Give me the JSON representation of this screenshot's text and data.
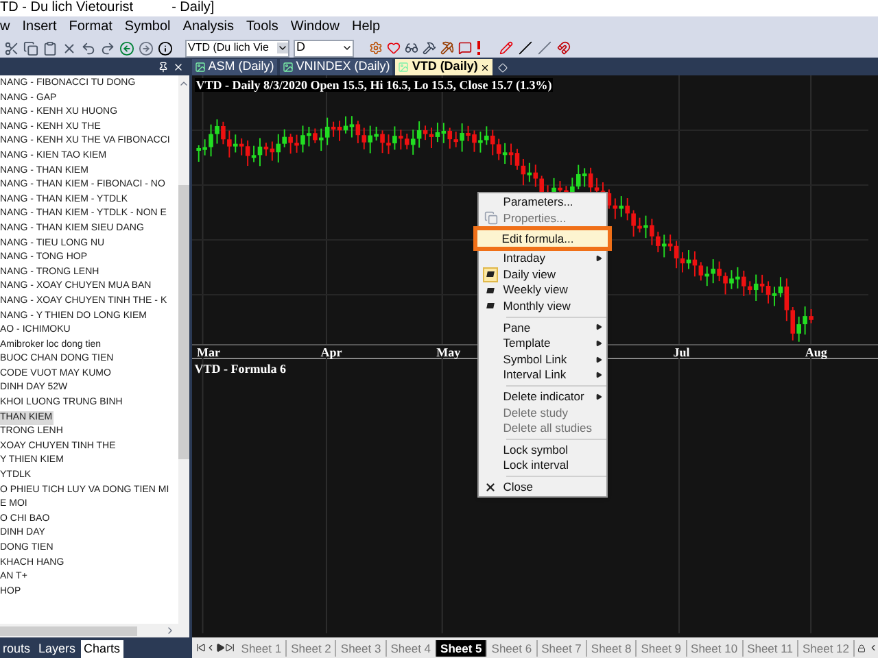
{
  "window": {
    "title": "TD - Du lich Vietourist",
    "title_suffix": "- Daily]"
  },
  "menu_bar": [
    "w",
    "Insert",
    "Format",
    "Symbol",
    "Analysis",
    "Tools",
    "Window",
    "Help"
  ],
  "toolbar": {
    "symbol_combo": "VTD (Du lich Vie",
    "interval_combo": "D"
  },
  "chart_tabs": [
    {
      "label": "ASM (Daily)",
      "selected": false
    },
    {
      "label": "VNINDEX (Daily)",
      "selected": false
    },
    {
      "label": "VTD (Daily)",
      "selected": true
    }
  ],
  "formula_list": [
    {
      "label": "NANG - FIBONACCI TU DONG",
      "selected": false
    },
    {
      "label": "NANG - GAP",
      "selected": false
    },
    {
      "label": "NANG - KENH XU HUONG",
      "selected": false
    },
    {
      "label": "NANG - KENH XU THE",
      "selected": false
    },
    {
      "label": "NANG - KENH XU THE VA FIBONACCI",
      "selected": false
    },
    {
      "label": "NANG - KIEN TAO KIEM",
      "selected": false
    },
    {
      "label": "NANG - THAN KIEM",
      "selected": false
    },
    {
      "label": "NANG - THAN KIEM - FIBONACI - NO",
      "selected": false
    },
    {
      "label": "NANG - THAN KIEM - YTDLK",
      "selected": false
    },
    {
      "label": "NANG - THAN KIEM - YTDLK - NON E",
      "selected": false
    },
    {
      "label": "NANG - THAN KIEM SIEU DANG",
      "selected": false
    },
    {
      "label": "NANG - TIEU LONG NU",
      "selected": false
    },
    {
      "label": "NANG - TONG HOP",
      "selected": false
    },
    {
      "label": "NANG - TRONG LENH",
      "selected": false
    },
    {
      "label": "NANG - XOAY CHUYEN MUA BAN",
      "selected": false
    },
    {
      "label": "NANG - XOAY CHUYEN TINH THE - K",
      "selected": false
    },
    {
      "label": "NANG - Y THIEN DO LONG KIEM",
      "selected": false
    },
    {
      "label": "AO - ICHIMOKU",
      "selected": false
    },
    {
      "label": "Amibroker loc dong tien",
      "selected": false
    },
    {
      "label": "BUOC CHAN DONG TIEN",
      "selected": false
    },
    {
      "label": "CODE VUOT MAY KUMO",
      "selected": false
    },
    {
      "label": "DINH DAY 52W",
      "selected": false
    },
    {
      "label": "KHOI LUONG TRUNG BINH",
      "selected": false
    },
    {
      "label": "THAN KIEM",
      "selected": true
    },
    {
      "label": "TRONG LENH",
      "selected": false
    },
    {
      "label": "XOAY CHUYEN TINH THE",
      "selected": false
    },
    {
      "label": "Y THIEN KIEM",
      "selected": false
    },
    {
      "label": "YTDLK",
      "selected": false
    },
    {
      "label": "O PHIEU TICH LUY VA DONG TIEN MI",
      "selected": false
    },
    {
      "label": "E MOI",
      "selected": false
    },
    {
      "label": "O CHI BAO",
      "selected": false
    },
    {
      "label": "DINH DAY",
      "selected": false
    },
    {
      "label": "DONG TIEN",
      "selected": false
    },
    {
      "label": "KHACH HANG",
      "selected": false
    },
    {
      "label": "AN T+",
      "selected": false
    },
    {
      "label": "HOP",
      "selected": false
    }
  ],
  "panel_tabs": [
    {
      "label": "routs",
      "selected": false
    },
    {
      "label": "Layers",
      "selected": false
    },
    {
      "label": "Charts",
      "selected": true
    }
  ],
  "chart": {
    "price_title": "VTD - Daily 8/3/2020 Open 15.5, Hi 16.5, Lo 15.5, Close 15.7 (1.3%)",
    "months": [
      {
        "label": "Mar"
      },
      {
        "label": "Apr"
      },
      {
        "label": "May"
      },
      {
        "label": "Jul"
      },
      {
        "label": "Aug"
      }
    ],
    "lower_title": "VTD - Formula 6"
  },
  "context_menu": [
    {
      "kind": "item",
      "label": "Parameters...",
      "disabled": false,
      "highlighted": false
    },
    {
      "kind": "item",
      "label": "Properties...",
      "disabled": true,
      "highlighted": false
    },
    {
      "kind": "item",
      "label": "Edit formula...",
      "disabled": false,
      "highlighted": true
    },
    {
      "kind": "submenu",
      "label": "Intraday",
      "disabled": false,
      "highlighted": false
    },
    {
      "kind": "view",
      "label": "Daily view",
      "disabled": false,
      "highlighted": false,
      "checked": true
    },
    {
      "kind": "view",
      "label": "Weekly view",
      "disabled": false,
      "highlighted": false,
      "checked": false
    },
    {
      "kind": "view",
      "label": "Monthly view",
      "disabled": false,
      "highlighted": false,
      "checked": false
    },
    {
      "kind": "separator"
    },
    {
      "kind": "submenu",
      "label": "Pane",
      "disabled": false,
      "highlighted": false
    },
    {
      "kind": "submenu",
      "label": "Template",
      "disabled": false,
      "highlighted": false
    },
    {
      "kind": "submenu",
      "label": "Symbol Link",
      "disabled": false,
      "highlighted": false
    },
    {
      "kind": "submenu",
      "label": "Interval Link",
      "disabled": false,
      "highlighted": false
    },
    {
      "kind": "separator"
    },
    {
      "kind": "submenu",
      "label": "Delete indicator",
      "disabled": false,
      "highlighted": false
    },
    {
      "kind": "item",
      "label": "Delete study",
      "disabled": true,
      "highlighted": false
    },
    {
      "kind": "item",
      "label": "Delete all studies",
      "disabled": true,
      "highlighted": false
    },
    {
      "kind": "separator"
    },
    {
      "kind": "item",
      "label": "Lock symbol",
      "disabled": false,
      "highlighted": false
    },
    {
      "kind": "item",
      "label": "Lock interval",
      "disabled": false,
      "highlighted": false
    },
    {
      "kind": "separator"
    },
    {
      "kind": "close",
      "label": "Close",
      "disabled": false,
      "highlighted": false
    }
  ],
  "sheet_tabs": [
    {
      "label": "Sheet 1",
      "selected": false
    },
    {
      "label": "Sheet 2",
      "selected": false
    },
    {
      "label": "Sheet 3",
      "selected": false
    },
    {
      "label": "Sheet 4",
      "selected": false
    },
    {
      "label": "Sheet 5",
      "selected": true
    },
    {
      "label": "Sheet 6",
      "selected": false
    },
    {
      "label": "Sheet 7",
      "selected": false
    },
    {
      "label": "Sheet 8",
      "selected": false
    },
    {
      "label": "Sheet 9",
      "selected": false
    },
    {
      "label": "Sheet 10",
      "selected": false
    },
    {
      "label": "Sheet 11",
      "selected": false
    },
    {
      "label": "Sheet 12",
      "selected": false
    }
  ]
}
